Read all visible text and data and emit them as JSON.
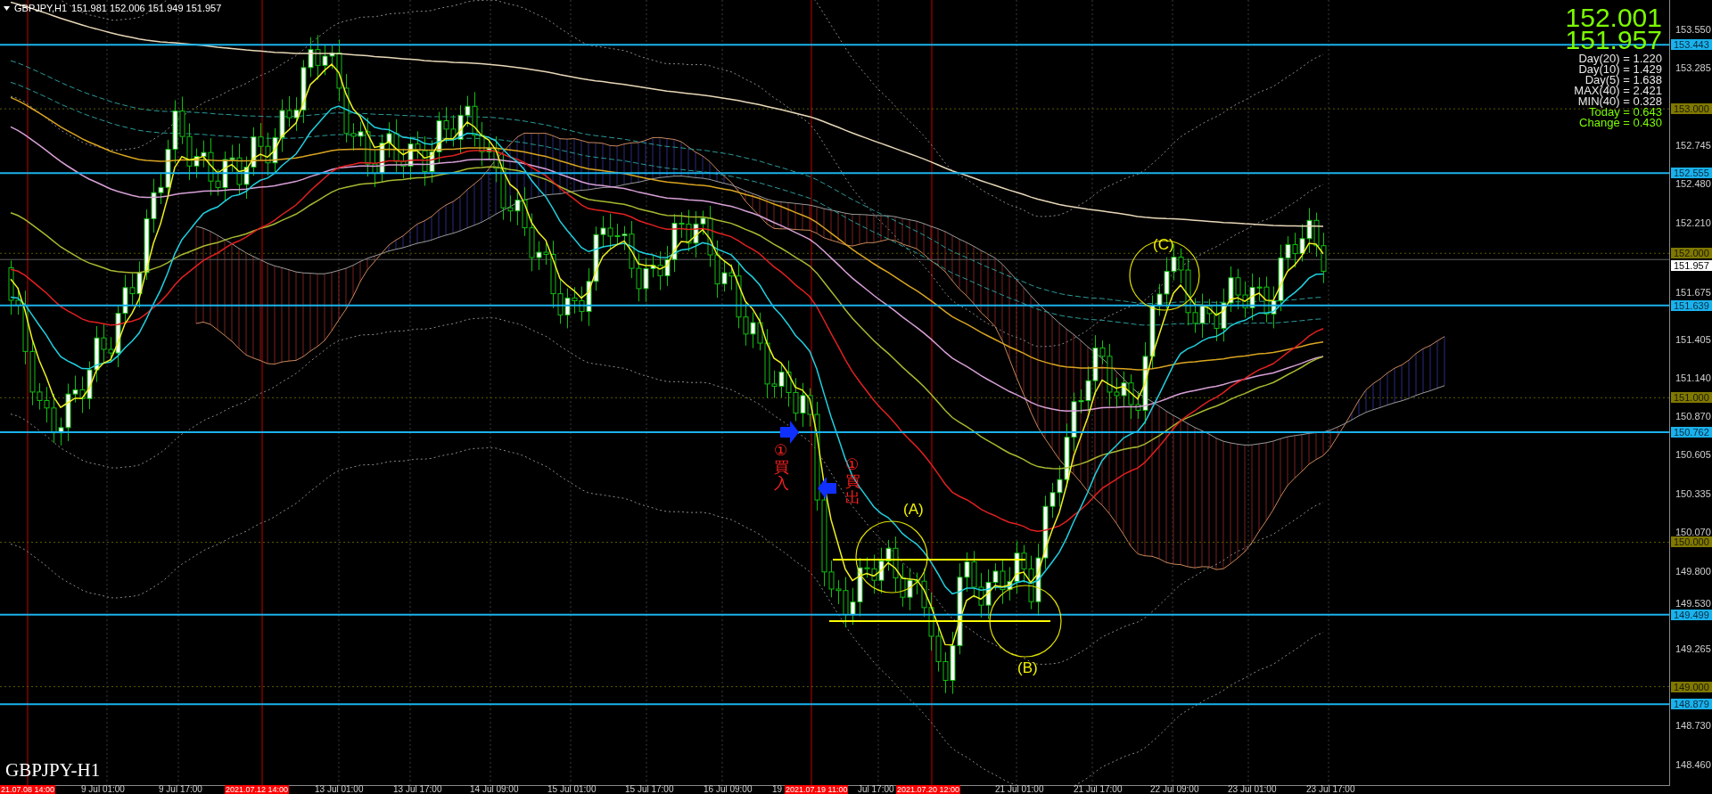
{
  "chart_header": {
    "symbol": "GBPJPY,H1",
    "ohlc": "151.981 152.006 151.949 151.957"
  },
  "symbol_label": "GBPJPY-H1",
  "quote": {
    "ask": "152.001",
    "bid": "151.957"
  },
  "stats": [
    {
      "text": "Day(20) = 1.220",
      "kind": "range"
    },
    {
      "text": "Day(10) = 1.429",
      "kind": "range"
    },
    {
      "text": "Day(5) = 1.638",
      "kind": "range"
    },
    {
      "text": "MAX(40) = 2.421",
      "kind": "range"
    },
    {
      "text": "MIN(40) = 0.328",
      "kind": "range"
    },
    {
      "text": "Today = 0.643",
      "kind": "change"
    },
    {
      "text": "Change = 0.430",
      "kind": "change"
    }
  ],
  "price_axis": {
    "ticks": [
      "153.550",
      "153.285",
      "152.745",
      "152.480",
      "152.210",
      "151.675",
      "151.405",
      "151.140",
      "150.870",
      "150.605",
      "150.335",
      "150.070",
      "149.800",
      "149.530",
      "149.265",
      "148.730",
      "148.460"
    ],
    "levels": [
      {
        "label": "153.443",
        "kind": "line"
      },
      {
        "label": "153.000",
        "kind": "round"
      },
      {
        "label": "152.555",
        "kind": "line"
      },
      {
        "label": "152.000",
        "kind": "round"
      },
      {
        "label": "151.957",
        "kind": "bid"
      },
      {
        "label": "151.639",
        "kind": "line"
      },
      {
        "label": "151.000",
        "kind": "round"
      },
      {
        "label": "150.762",
        "kind": "line"
      },
      {
        "label": "150.000",
        "kind": "round"
      },
      {
        "label": "149.499",
        "kind": "line"
      },
      {
        "label": "149.000",
        "kind": "round"
      },
      {
        "label": "148.879",
        "kind": "line"
      }
    ]
  },
  "time_axis": [
    {
      "label": "21.07.08 14:00",
      "kind": "marker"
    },
    {
      "label": "9 Jul 01:00",
      "kind": "tick"
    },
    {
      "label": "9 Jul 17:00",
      "kind": "tick"
    },
    {
      "label": "2021.07.12 14:00",
      "kind": "marker"
    },
    {
      "label": "13 Jul 01:00",
      "kind": "tick"
    },
    {
      "label": "13 Jul 17:00",
      "kind": "tick"
    },
    {
      "label": "14 Jul 09:00",
      "kind": "tick"
    },
    {
      "label": "15 Jul 01:00",
      "kind": "tick"
    },
    {
      "label": "15 Jul 17:00",
      "kind": "tick"
    },
    {
      "label": "16 Jul 09:00",
      "kind": "tick"
    },
    {
      "label": "19",
      "kind": "tick"
    },
    {
      "label": "2021.07.19 11:00",
      "kind": "marker"
    },
    {
      "label": "Jul 17:00",
      "kind": "tick"
    },
    {
      "label": "2021.07.20 12:00",
      "kind": "marker"
    },
    {
      "label": "21 Jul 01:00",
      "kind": "tick"
    },
    {
      "label": "21 Jul 17:00",
      "kind": "tick"
    },
    {
      "label": "22 Jul 09:00",
      "kind": "tick"
    },
    {
      "label": "23 Jul 01:00",
      "kind": "tick"
    },
    {
      "label": "23 Jul 17:00",
      "kind": "tick"
    }
  ],
  "annotations": [
    {
      "text": "①買入",
      "kind": "signal"
    },
    {
      "text": "①買出",
      "kind": "signal"
    },
    {
      "text": "(A)",
      "kind": "label"
    },
    {
      "text": "(B)",
      "kind": "label"
    },
    {
      "text": "(C)",
      "kind": "label"
    }
  ]
}
